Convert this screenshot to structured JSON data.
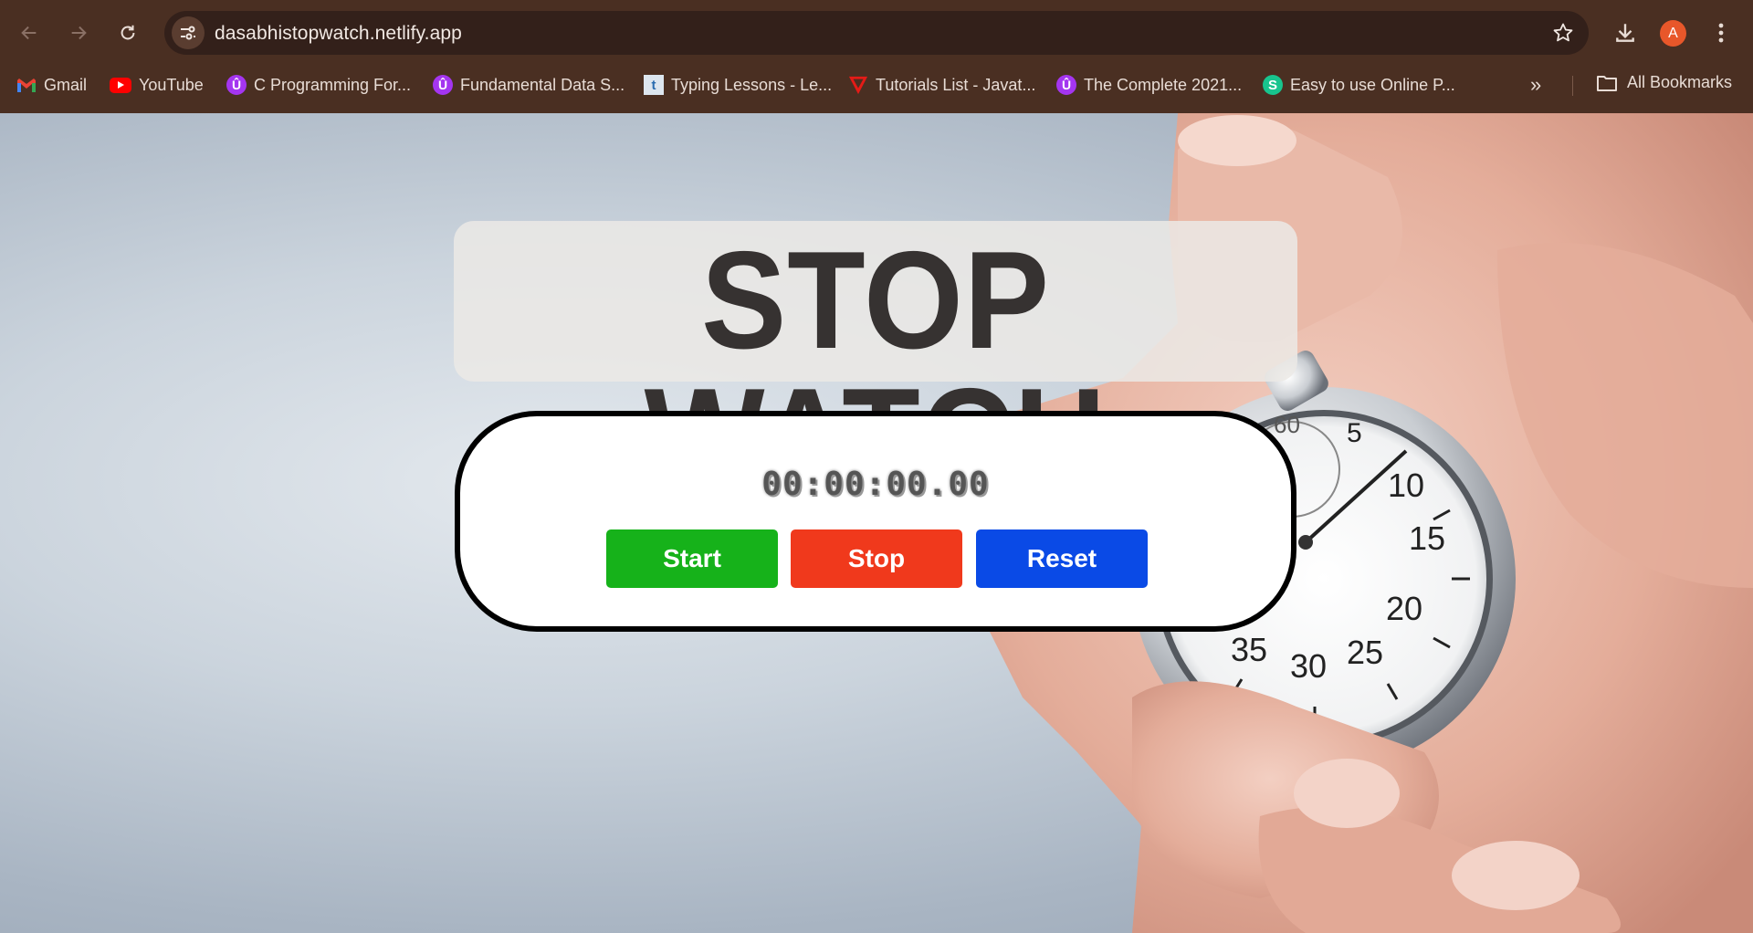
{
  "browser": {
    "url": "dasabhistopwatch.netlify.app",
    "avatar_letter": "A",
    "bookmarks": [
      {
        "label": "Gmail",
        "icon": "gmail-icon"
      },
      {
        "label": "YouTube",
        "icon": "youtube-icon"
      },
      {
        "label": "C Programming For...",
        "icon": "udemy-icon"
      },
      {
        "label": "Fundamental Data S...",
        "icon": "udemy-icon"
      },
      {
        "label": "Typing Lessons - Le...",
        "icon": "typing-icon"
      },
      {
        "label": "Tutorials List - Javat...",
        "icon": "javatpoint-icon"
      },
      {
        "label": "The Complete 2021...",
        "icon": "udemy-icon"
      },
      {
        "label": "Easy to use Online P...",
        "icon": "s-icon"
      }
    ],
    "more_label": "»",
    "all_bookmarks_label": "All Bookmarks"
  },
  "app": {
    "title": "STOP WATCH",
    "time": "00:00:00.00",
    "buttons": {
      "start": "Start",
      "stop": "Stop",
      "reset": "Reset"
    },
    "colors": {
      "start": "#16b21a",
      "stop": "#f0391c",
      "reset": "#0a4ae6"
    }
  }
}
